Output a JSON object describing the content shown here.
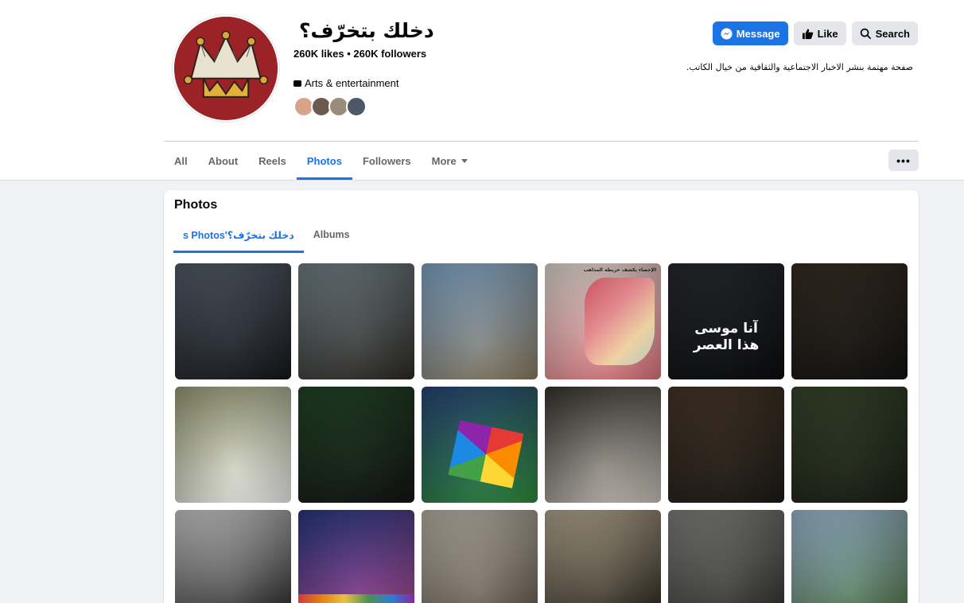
{
  "page": {
    "name": "دخلك بتخرّف؟",
    "stats": "260K likes • 260K followers",
    "category": "Arts & entertainment",
    "category_icon": "briefcase-icon",
    "about": "صفحة مهتمة بنشر الاخبار الاجتماعية والثقافية من خيال الكاتب."
  },
  "actions": {
    "message_label": "Message",
    "like_label": "Like",
    "search_label": "Search"
  },
  "tabs": [
    {
      "label": "All",
      "active": false
    },
    {
      "label": "About",
      "active": false
    },
    {
      "label": "Reels",
      "active": false
    },
    {
      "label": "Photos",
      "active": true
    },
    {
      "label": "Followers",
      "active": false
    },
    {
      "label": "More",
      "active": false
    }
  ],
  "more_button_label": "•••",
  "photos_section": {
    "title": "Photos",
    "subtabs": [
      {
        "label": "دخلك بتخرّف؟'s Photos",
        "active": true
      },
      {
        "label": "Albums",
        "active": false
      }
    ]
  },
  "photo_texts": {
    "p5_line1": "آنا موسى",
    "p5_line2": "هذا العصر",
    "p4_title": "الإحصاء يكشف خريطة المذاهب"
  },
  "colors": {
    "accent": "#1b74e4",
    "avatar_bg": "#9b2226"
  },
  "photos": [
    {
      "id": "p1",
      "c1": "#5a6470",
      "c2": "#15171b",
      "subject": "veiled-woman-photo"
    },
    {
      "id": "p2",
      "c1": "#7a8a92",
      "c2": "#2e2a24",
      "subject": "politician-pointing-photo"
    },
    {
      "id": "p3",
      "c1": "#8bb3d9",
      "c2": "#8a7a60",
      "subject": "statue-square-photo"
    },
    {
      "id": "p4",
      "c1": "#f3ece4",
      "c2": "#d9727a",
      "subject": "sect-map-infographic"
    },
    {
      "id": "p5",
      "c1": "#2a2d33",
      "c2": "#0b0c0e",
      "subject": "man-portrait-text-photo"
    },
    {
      "id": "p6",
      "c1": "#3a3025",
      "c2": "#121212",
      "subject": "speech-podium-photo"
    },
    {
      "id": "p7",
      "c1": "#a4a87e",
      "c2": "#eeeeee",
      "subject": "cleric-speaking-photo"
    },
    {
      "id": "p8",
      "c1": "#264a2a",
      "c2": "#131313",
      "subject": "referee-pitch-photo"
    },
    {
      "id": "p9",
      "c1": "#2d4a80",
      "c2": "#2f8a3a",
      "subject": "rainbow-flag-photo"
    },
    {
      "id": "p10",
      "c1": "#3b3833",
      "c2": "#c9c4bb",
      "subject": "sheikhs-gathering-photo"
    },
    {
      "id": "p11",
      "c1": "#4a3a2a",
      "c2": "#1c1a17",
      "subject": "cracked-phone-photo"
    },
    {
      "id": "p12",
      "c1": "#3a4a2e",
      "c2": "#1a1e16",
      "subject": "garden-palace-photo"
    },
    {
      "id": "p13",
      "c1": "#dcdcdc",
      "c2": "#1a1a1a",
      "subject": "couple-flags-photo"
    },
    {
      "id": "p14",
      "c1": "#2a3d8a",
      "c2": "#b34b8f",
      "subject": "stadium-photo"
    },
    {
      "id": "p15",
      "c1": "#c9c2b4",
      "c2": "#5a5046",
      "subject": "office-meeting-photo"
    },
    {
      "id": "p16",
      "c1": "#c2b59b",
      "c2": "#1e1a15",
      "subject": "bearded-man-photo"
    },
    {
      "id": "p17",
      "c1": "#8a8c88",
      "c2": "#2a2826",
      "subject": "crowd-crash-photo"
    },
    {
      "id": "p18",
      "c1": "#a9c9e6",
      "c2": "#4a6b3a",
      "subject": "warehouse-photo"
    }
  ]
}
